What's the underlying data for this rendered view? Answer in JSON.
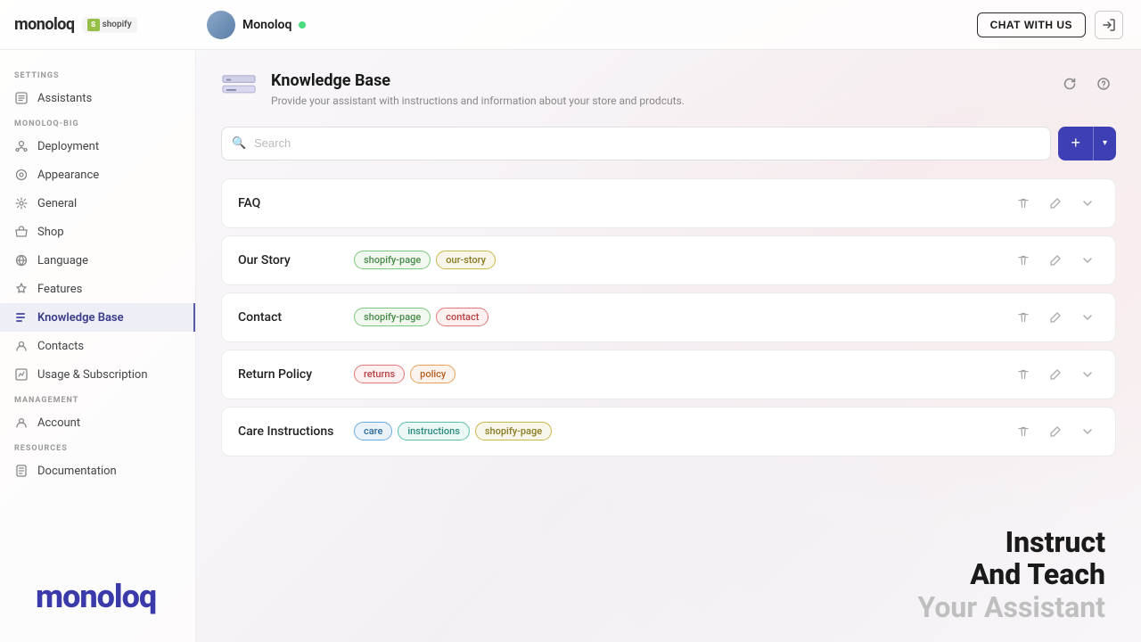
{
  "topbar": {
    "logo": "monoloq",
    "shopify_label": "shopify",
    "user_name": "Monoloq",
    "chat_btn": "CHAT WITH US",
    "logout_icon": "→"
  },
  "sidebar": {
    "settings_label": "SETTINGS",
    "assistants_label": "Assistants",
    "monoloq_big_label": "MONOLOQ-BIG",
    "items": [
      {
        "id": "deployment",
        "label": "Deployment"
      },
      {
        "id": "appearance",
        "label": "Appearance"
      },
      {
        "id": "general",
        "label": "General"
      },
      {
        "id": "shop",
        "label": "Shop"
      },
      {
        "id": "language",
        "label": "Language"
      },
      {
        "id": "features",
        "label": "Features"
      },
      {
        "id": "knowledge-base",
        "label": "Knowledge Base",
        "active": true
      },
      {
        "id": "contacts",
        "label": "Contacts"
      },
      {
        "id": "usage",
        "label": "Usage & Subscription"
      }
    ],
    "management_label": "MANAGEMENT",
    "account_label": "Account",
    "resources_label": "RESOURCES",
    "documentation_label": "Documentation"
  },
  "page": {
    "title": "Knowledge Base",
    "subtitle": "Provide your assistant with instructions and information about your store and prodcuts.",
    "search_placeholder": "Search"
  },
  "knowledge_items": [
    {
      "id": "faq",
      "name": "FAQ",
      "tags": []
    },
    {
      "id": "our-story",
      "name": "Our Story",
      "tags": [
        {
          "label": "shopify-page",
          "style": "green"
        },
        {
          "label": "our-story",
          "style": "yellow"
        }
      ]
    },
    {
      "id": "contact",
      "name": "Contact",
      "tags": [
        {
          "label": "shopify-page",
          "style": "green"
        },
        {
          "label": "contact",
          "style": "pink"
        }
      ]
    },
    {
      "id": "return-policy",
      "name": "Return Policy",
      "tags": [
        {
          "label": "returns",
          "style": "pink"
        },
        {
          "label": "policy",
          "style": "orange"
        }
      ]
    },
    {
      "id": "care-instructions",
      "name": "Care Instructions",
      "tags": [
        {
          "label": "care",
          "style": "blue"
        },
        {
          "label": "instructions",
          "style": "teal"
        },
        {
          "label": "shopify-page",
          "style": "yellow"
        }
      ]
    }
  ],
  "bottom": {
    "logo": "monoloq",
    "tagline_line1": "Instruct",
    "tagline_line2": "And Teach",
    "tagline_line3": "Your Assistant"
  }
}
